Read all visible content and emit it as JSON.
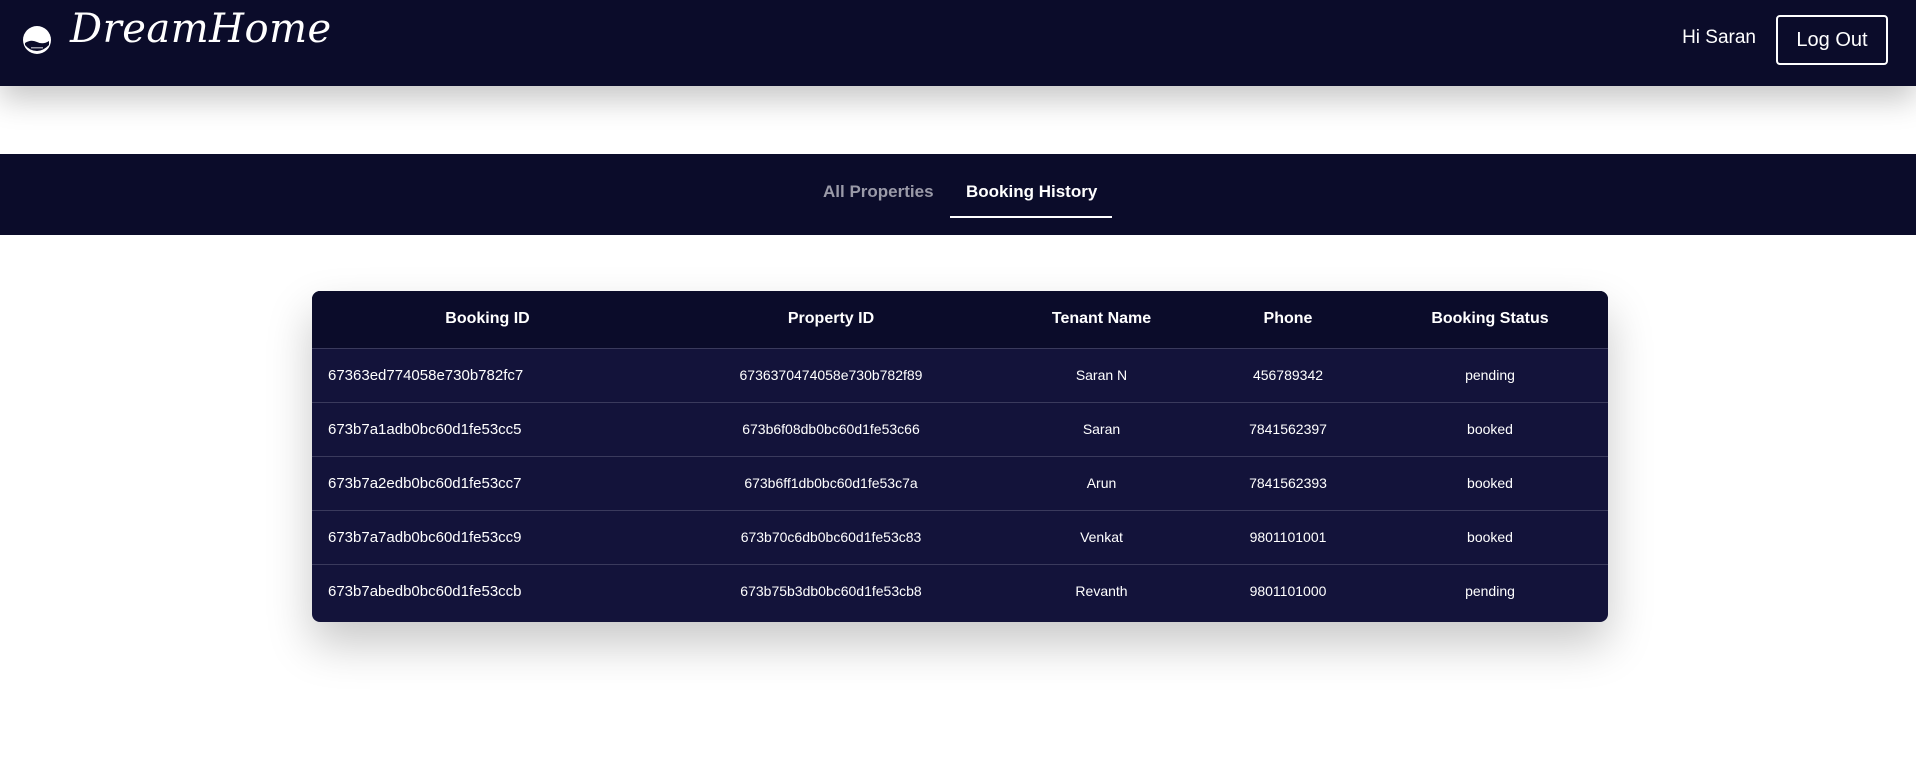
{
  "header": {
    "brand": "DreamHome",
    "greeting": "Hi Saran",
    "logout_label": "Log Out"
  },
  "tabs": [
    {
      "label": "All Properties",
      "active": false
    },
    {
      "label": "Booking History",
      "active": true
    }
  ],
  "table": {
    "columns": [
      "Booking ID",
      "Property ID",
      "Tenant Name",
      "Phone",
      "Booking Status"
    ],
    "rows": [
      [
        "67363ed774058e730b782fc7",
        "673637047405​8e730b782f89",
        "Saran N",
        "456789342",
        "pending"
      ],
      [
        "673b7a1adb0bc60d1fe53cc5",
        "673b6f08db0bc60d1fe53c66",
        "Saran",
        "7841562397",
        "booked"
      ],
      [
        "673b7a2edb0bc60d1fe53cc7",
        "673b6ff1db0bc60d1fe53c7a",
        "Arun",
        "7841562393",
        "booked"
      ],
      [
        "673b7a7adb0bc60d1fe53cc9",
        "673b70c6db0bc60d1fe53c83",
        "Venkat",
        "9801101001",
        "booked"
      ],
      [
        "673b7abedb0bc60d1fe53ccb",
        "673b75b3db0bc60d1fe53cb8",
        "Revanth",
        "9801101000",
        "pending"
      ]
    ]
  },
  "colors": {
    "navy": "#0b0c2a",
    "table_body": "#13133a",
    "inactive_tab": "#9a9aa8"
  },
  "icons": {
    "logo": "moon-house-emblem-icon"
  }
}
